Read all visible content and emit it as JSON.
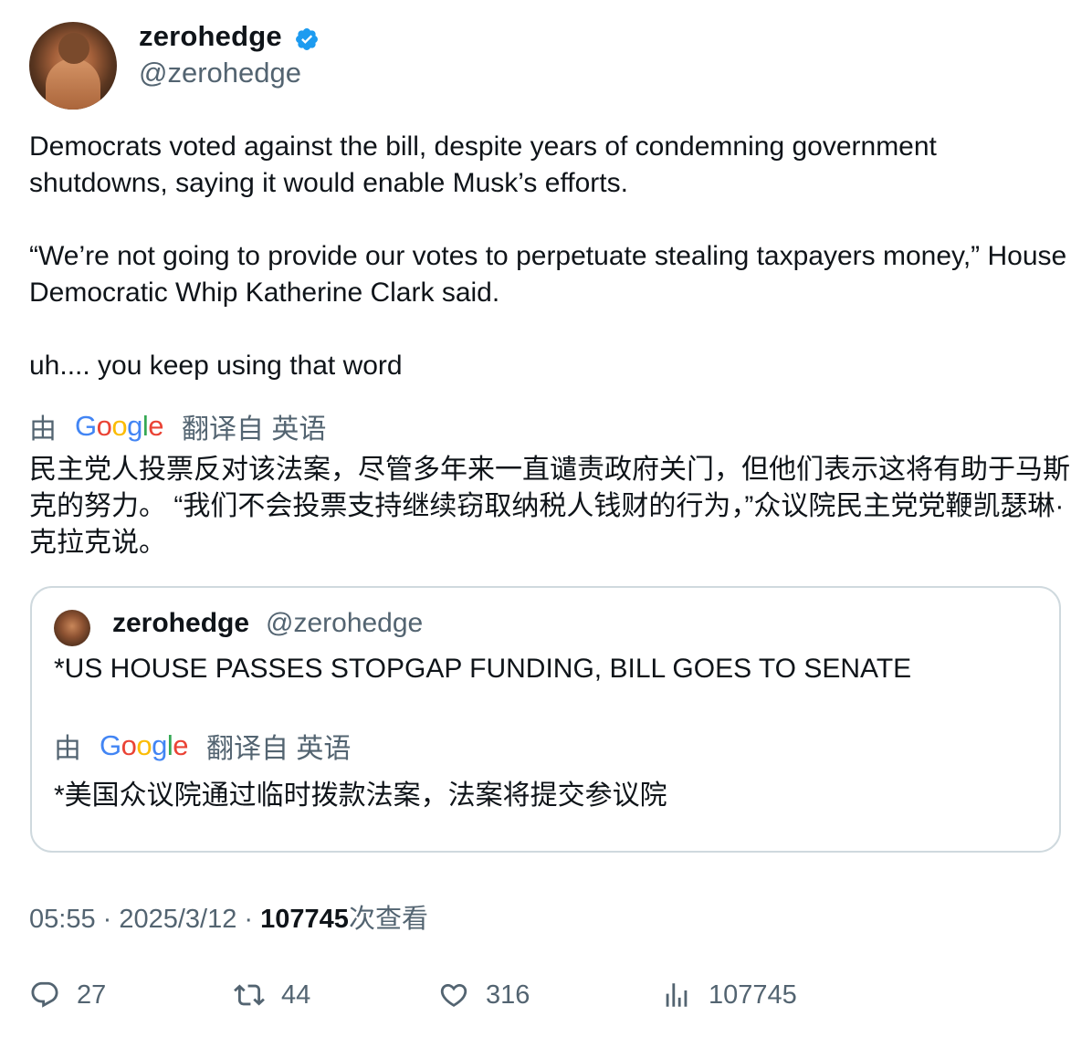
{
  "author": {
    "name": "zerohedge",
    "handle": "@zerohedge",
    "verified_color": "#1d9bf0"
  },
  "tweet": {
    "paragraphs": [
      "Democrats voted against the bill, despite years of condemning government shutdowns, saying it would enable Musk’s efforts.",
      "“We’re not going to provide our votes to perpetuate stealing taxpayers money,” House Democratic Whip Katherine Clark said.",
      "uh.... you keep using that word"
    ],
    "translated_by_prefix": "由",
    "translated_by_suffix": "翻译自 英语",
    "google": [
      "G",
      "o",
      "o",
      "g",
      "l",
      "e"
    ],
    "translation": "民主党人投票反对该法案，尽管多年来一直谴责政府关门，但他们表示这将有助于马斯克的努力。 “我们不会投票支持继续窃取纳税人钱财的行为，”众议院民主党党鞭凯瑟琳·克拉克说。"
  },
  "quote": {
    "name": "zerohedge",
    "handle": "@zerohedge",
    "text": "*US HOUSE PASSES STOPGAP FUNDING, BILL GOES TO SENATE",
    "translated_by_prefix": "由",
    "translated_by_suffix": "翻译自 英语",
    "translation": "*美国众议院通过临时拨款法案，法案将提交参议院"
  },
  "meta": {
    "time": "05:55",
    "date": "2025/3/12",
    "views": "107745",
    "views_label": "次查看"
  },
  "actions": {
    "replies": "27",
    "retweets": "44",
    "likes": "316",
    "views": "107745"
  }
}
